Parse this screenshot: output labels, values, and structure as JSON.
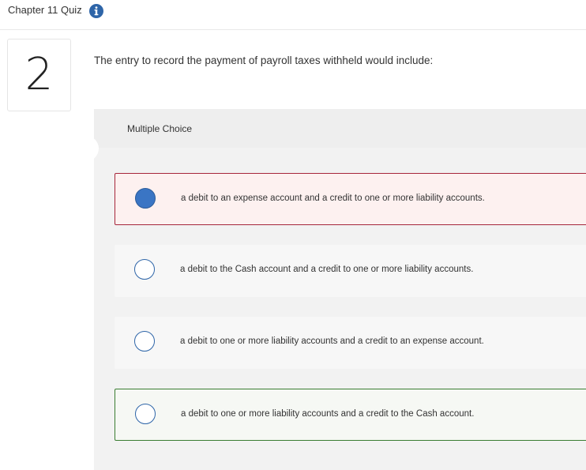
{
  "header": {
    "quiz_title": "Chapter 11 Quiz",
    "info_icon": "info-icon",
    "accent_color": "#2e65a8"
  },
  "question": {
    "number": "2",
    "prompt": "The entry to record the payment of payroll taxes withheld would include:",
    "type_label": "Multiple Choice"
  },
  "choices": [
    {
      "label": "a debit to an expense account and a credit to one or more liability accounts.",
      "selected": true,
      "status": "incorrect"
    },
    {
      "label": "a debit to the Cash account and a credit to one or more liability accounts.",
      "selected": false,
      "status": "none"
    },
    {
      "label": "a debit to one or more liability accounts and a credit to an expense account.",
      "selected": false,
      "status": "none"
    },
    {
      "label": "a debit to one or more liability accounts and a credit to the Cash account.",
      "selected": false,
      "status": "correct"
    }
  ],
  "colors": {
    "incorrect_border": "#a6263b",
    "correct_border": "#3a7d32",
    "selected_radio": "#3a75c4"
  }
}
